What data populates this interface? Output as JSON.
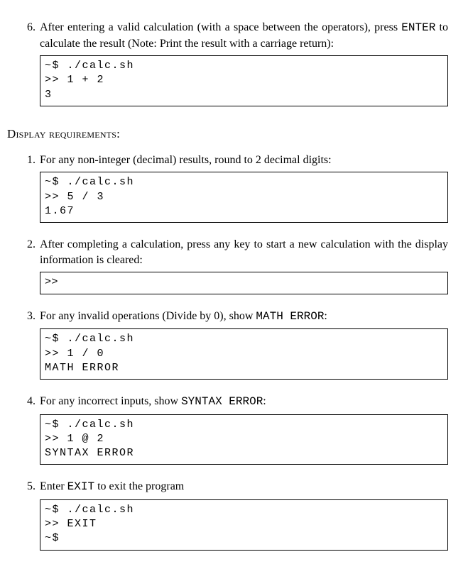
{
  "top_item": {
    "number": "6.",
    "text_before_enter": "After entering a valid calculation (with a space between the operators), press ",
    "enter": "ENTER",
    "text_after_enter": " to calculate the result (Note: Print the result with a carriage return):",
    "code": "~$ ./calc.sh\n>> 1 + 2\n3"
  },
  "section_heading": "Display requirements:",
  "items": [
    {
      "number": "1.",
      "text": "For any non-integer (decimal) results, round to 2 decimal digits:",
      "code": "~$ ./calc.sh\n>> 5 / 3\n1.67"
    },
    {
      "number": "2.",
      "text": "After completing a calculation, press any key to start a new calculation with the display information is cleared:",
      "code": ">>"
    },
    {
      "number": "3.",
      "text_before_tt": "For any invalid operations (Divide by 0), show ",
      "tt": "MATH ERROR",
      "text_after_tt": ":",
      "code": "~$ ./calc.sh\n>> 1 / 0\nMATH ERROR"
    },
    {
      "number": "4.",
      "text_before_tt": "For any incorrect inputs, show ",
      "tt": "SYNTAX ERROR",
      "text_after_tt": ":",
      "code": "~$ ./calc.sh\n>> 1 @ 2\nSYNTAX ERROR"
    },
    {
      "number": "5.",
      "text_before_tt": "Enter ",
      "tt": "EXIT",
      "text_after_tt": " to exit the program",
      "code": "~$ ./calc.sh\n>> EXIT\n~$"
    }
  ]
}
